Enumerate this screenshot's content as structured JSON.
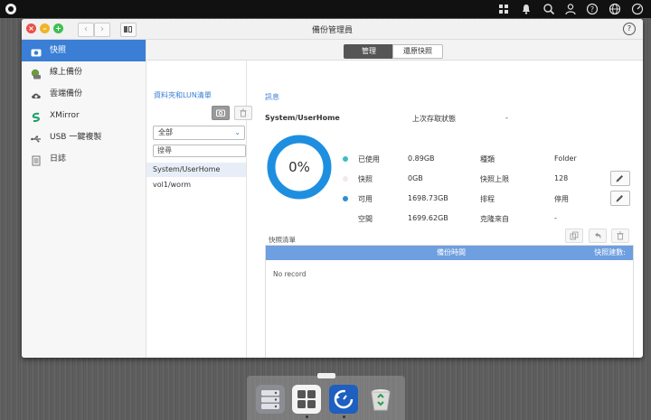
{
  "window": {
    "title": "備份管理員",
    "nav_prev": "‹",
    "nav_next": "›",
    "help": "?"
  },
  "tabs": [
    {
      "label": "管理",
      "active": true
    },
    {
      "label": "還原快照",
      "active": false
    }
  ],
  "sidebar": {
    "items": [
      {
        "label": "快照",
        "icon": "camera-icon",
        "active": true
      },
      {
        "label": "線上備份",
        "icon": "online-backup-icon",
        "active": false
      },
      {
        "label": "雲端備份",
        "icon": "cloud-backup-icon",
        "active": false
      },
      {
        "label": "XMirror",
        "icon": "xmirror-icon",
        "active": false
      },
      {
        "label": "USB 一鍵複製",
        "icon": "usb-icon",
        "active": false
      },
      {
        "label": "日誌",
        "icon": "log-icon",
        "active": false
      }
    ]
  },
  "folders": {
    "title": "資料夾和LUN清單",
    "filter_value": "全部",
    "search_placeholder": "搜尋",
    "rows": [
      {
        "label": "System/UserHome",
        "active": true
      },
      {
        "label": "vol1/worm",
        "active": false
      }
    ]
  },
  "info": {
    "title": "訊息",
    "path": "System/UserHome",
    "last_access_label": "上次存取狀態",
    "last_access_value": "-",
    "usage_percent": 0,
    "usage_text": "0%",
    "stats": [
      {
        "label": "已使用",
        "value": "0.89GB",
        "color": "#3bbfbf"
      },
      {
        "label": "快照",
        "value": "0GB",
        "color": "#f3e8f0"
      },
      {
        "label": "可用",
        "value": "1698.73GB",
        "color": "#2b8fd8"
      },
      {
        "label": "空間",
        "value": "1699.62GB",
        "color": ""
      }
    ],
    "props": [
      {
        "label": "種類",
        "value": "Folder"
      },
      {
        "label": "快照上限",
        "value": "128"
      },
      {
        "label": "排程",
        "value": "停用"
      },
      {
        "label": "克隆來自",
        "value": "-"
      }
    ]
  },
  "snapshots": {
    "title": "快照清單",
    "col_time": "備份時間",
    "col_count": "快照建數:",
    "empty": "No record"
  },
  "colors": {
    "accent": "#3a7fd5",
    "donut": "#1e8fe0",
    "header": "#6e9fe0"
  }
}
